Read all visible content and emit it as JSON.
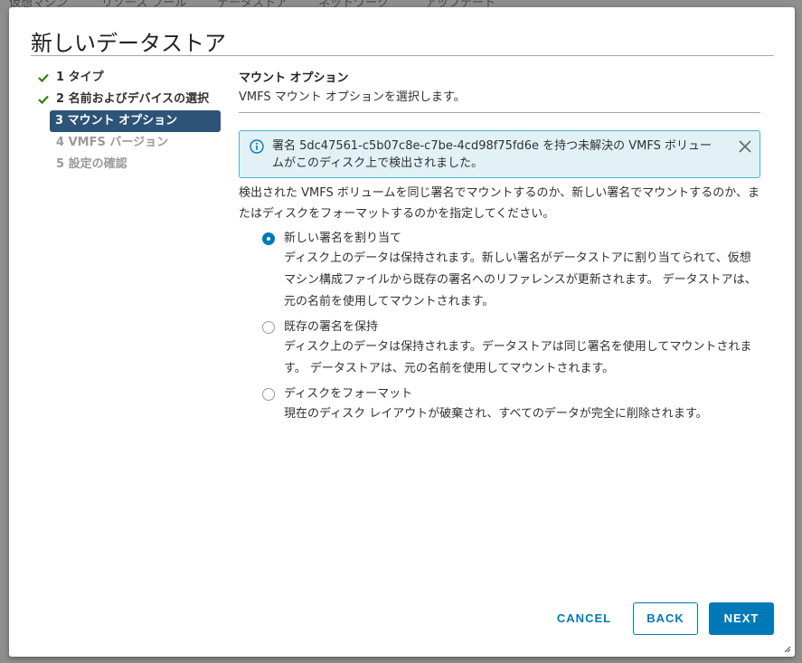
{
  "background": {
    "tabs": [
      "仮想マシン",
      "リソース プール",
      "データストア",
      "ネットワーク",
      "アップデート"
    ]
  },
  "dialog": {
    "title": "新しいデータストア",
    "steps": [
      {
        "label": "1 タイプ",
        "state": "done"
      },
      {
        "label": "2 名前およびデバイスの選択",
        "state": "done"
      },
      {
        "label": "3 マウント オプション",
        "state": "active"
      },
      {
        "label": "4 VMFS バージョン",
        "state": "pending"
      },
      {
        "label": "5 設定の確認",
        "state": "pending"
      }
    ],
    "section_title": "マウント オプション",
    "section_subtitle": "VMFS マウント オプションを選択します。",
    "alert": {
      "text": "署名 5dc47561-c5b07c8e-c7be-4cd98f75fd6e を持つ未解決の VMFS ボリュームがこのディスク上で検出されました。",
      "icon": "info-icon"
    },
    "description": "検出された VMFS ボリュームを同じ署名でマウントするのか、新しい署名でマウントするのか、またはディスクをフォーマットするのかを指定してください。",
    "options": [
      {
        "label": "新しい署名を割り当て",
        "description": "ディスク上のデータは保持されます。新しい署名がデータストアに割り当てられて、仮想マシン構成ファイルから既存の署名へのリファレンスが更新されます。 データストアは、元の名前を使用してマウントされます。",
        "checked": true
      },
      {
        "label": "既存の署名を保持",
        "description": "ディスク上のデータは保持されます。データストアは同じ署名を使用してマウントされます。 データストアは、元の名前を使用してマウントされます。",
        "checked": false
      },
      {
        "label": "ディスクをフォーマット",
        "description": "現在のディスク レイアウトが破棄され、すべてのデータが完全に削除されます。",
        "checked": false
      }
    ],
    "buttons": {
      "cancel": "CANCEL",
      "back": "BACK",
      "next": "NEXT"
    }
  },
  "colors": {
    "primary": "#0079b8",
    "active_step": "#2d5478",
    "check": "#2f8400",
    "alert_bg": "#e1f1f6",
    "alert_border": "#49afd9"
  }
}
